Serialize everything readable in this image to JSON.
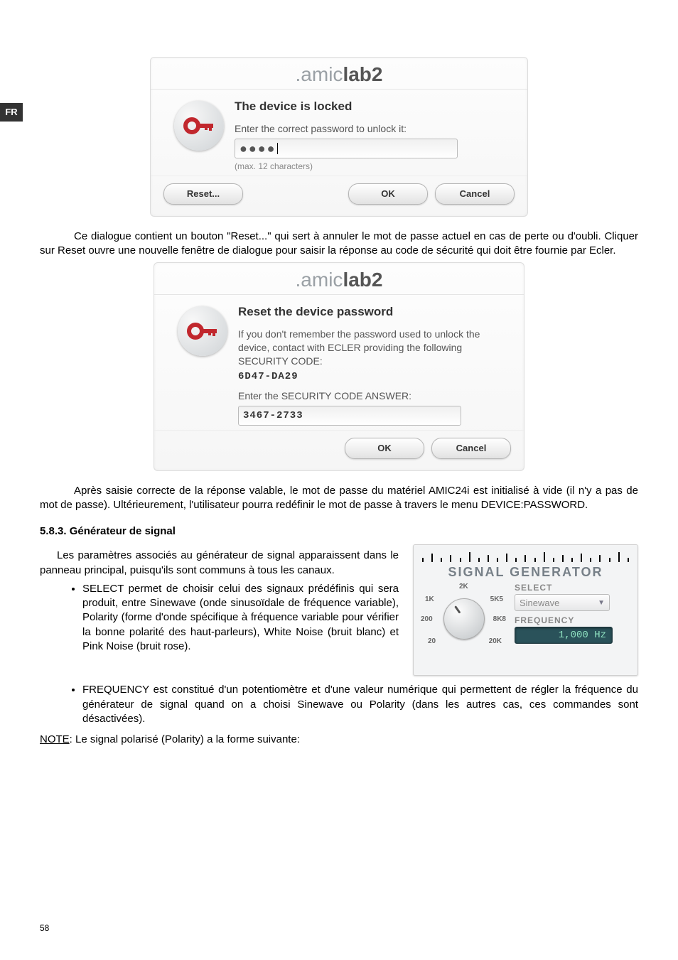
{
  "lang_badge": "FR",
  "dialog1": {
    "brand_prefix": ".amic",
    "brand_bold": "lab2",
    "heading": "The device is locked",
    "prompt": "Enter the correct password to unlock it:",
    "password_value": "●●●●",
    "hint": "(max. 12 characters)",
    "btn_reset": "Reset...",
    "btn_ok": "OK",
    "btn_cancel": "Cancel"
  },
  "para1": "Ce dialogue contient un bouton \"Reset...\" qui sert à annuler le mot de passe actuel en cas de perte ou d'oubli. Cliquer sur Reset ouvre une nouvelle fenêtre de dialogue pour saisir la réponse au code de sécurité qui doit être fournie par Ecler.",
  "dialog2": {
    "brand_prefix": ".amic",
    "brand_bold": "lab2",
    "heading": "Reset the device password",
    "text": "If you don't remember the password used to unlock the device, contact with ECLER providing the following SECURITY CODE:",
    "security_code": "6D47-DA29",
    "answer_label": "Enter the SECURITY CODE ANSWER:",
    "answer_value": "3467-2733",
    "btn_ok": "OK",
    "btn_cancel": "Cancel"
  },
  "para2": "Après saisie correcte de la réponse valable, le mot de passe du matériel AMIC24i est initialisé à vide (il n'y a pas de mot de passe). Ultérieurement, l'utilisateur pourra redéfinir le mot de passe à travers le menu DEVICE:PASSWORD.",
  "section_heading": "5.8.3. Générateur de signal",
  "para3": "Les paramètres associés au générateur de signal apparaissent dans le panneau principal, puisqu'ils sont communs à tous les canaux.",
  "bullet1": "SELECT permet de choisir celui des signaux prédéfinis qui sera produit, entre Sinewave (onde sinusoïdale de fréquence variable), Polarity (forme d'onde spécifique à fréquence variable pour vérifier la bonne polarité des haut-parleurs), White Noise (bruit blanc) et Pink Noise (bruit rose).",
  "bullet2": "FREQUENCY est constitué d'un potentiomètre et d'une valeur numérique qui permettent de régler la fréquence du générateur de signal quand on a choisi Sinewave ou Polarity (dans les autres cas, ces commandes sont désactivées).",
  "note_label": "NOTE",
  "note_text": ": Le signal polarisé (Polarity) a la forme suivante:",
  "siggen": {
    "title": "SIGNAL GENERATOR",
    "ticks": {
      "t1": "1K",
      "t2": "2K",
      "t3": "5K5",
      "t4": "8K8",
      "t5": "200",
      "t6": "20",
      "t7": "20K"
    },
    "select_label": "SELECT",
    "select_value": "Sinewave",
    "freq_label": "FREQUENCY",
    "freq_value": "1,000 Hz"
  },
  "page_number": "58"
}
